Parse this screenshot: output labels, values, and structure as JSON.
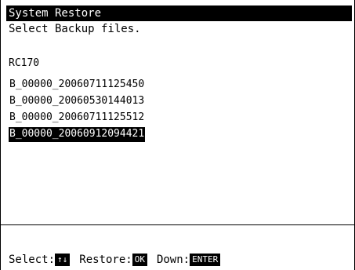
{
  "window": {
    "title": "System Restore",
    "subtitle": "Select Backup files."
  },
  "group": {
    "label": "RC170"
  },
  "files": [
    "B_00000_20060711125450",
    "B_00000_20060530144013",
    "B_00000_20060711125512",
    "B_00000_20060912094421"
  ],
  "selected_index": 3,
  "status_bar": {
    "select_label": "Select:",
    "select_key": "↑↓",
    "restore_label": "Restore:",
    "restore_key": "OK",
    "down_label": "Down:",
    "down_key": "ENTER"
  },
  "colors": {
    "background": "#ffffff",
    "foreground": "#000000",
    "highlight": "#000000"
  }
}
